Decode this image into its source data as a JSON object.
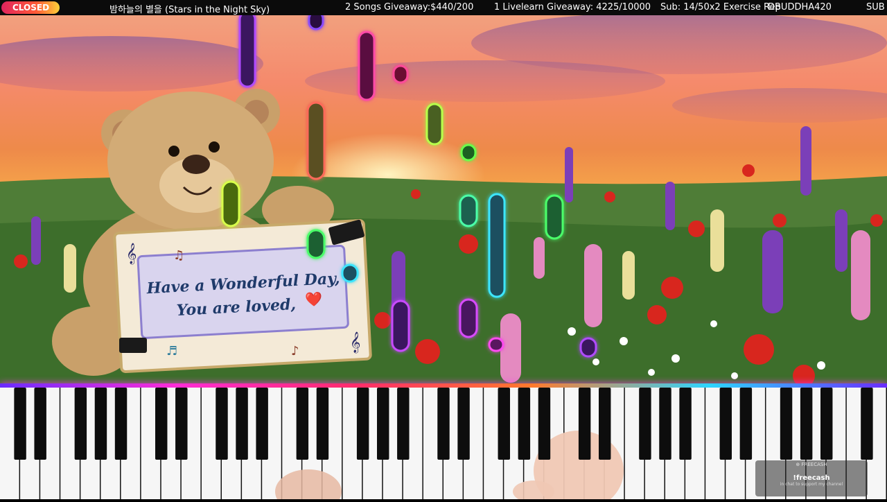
{
  "topbar": {
    "closed_label": "CLOSED",
    "song_title": "밤하늘의 별을 (Stars in the Night Sky)",
    "songs_giveaway": "2 Songs Giveaway:$440/200",
    "livelearn_giveaway": "1 Livelearn Giveaway: 4225/10000",
    "sub_goal": "Sub: 14/50x2 Exercise Rep",
    "username": "DBUDDHA420",
    "sub_label": "SUB"
  },
  "sign": {
    "line1": "Have a Wonderful Day,",
    "line2": "You are loved,",
    "heart": "❤️"
  },
  "freecash": {
    "brand": "⊕ FREECASH",
    "command": "!freecash",
    "caption": "in chat to support my channel"
  },
  "colors": {
    "accent_purple": "#b14cff",
    "accent_pink": "#ff3cc8",
    "accent_green": "#4cff6a",
    "accent_cyan": "#3ce6ff"
  }
}
